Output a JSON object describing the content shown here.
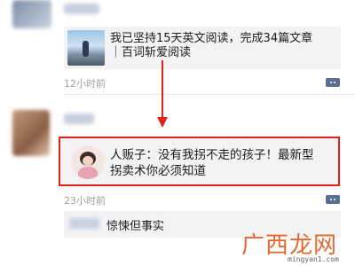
{
  "feed": {
    "post1": {
      "card_text_line1": "我已坚持15天英文阅读，完成34篇文章",
      "card_text_line2": "｜百词斩爱阅读",
      "time": "12小时前"
    },
    "post2": {
      "card_text_line1": "人贩子：没有我拐不走的孩子！最新型",
      "card_text_line2": "拐卖术你必须知道",
      "time": "23小时前",
      "comment_text": "惊悚但事实"
    }
  },
  "colors": {
    "highlight": "#e2231a",
    "more_button": "#5a6d93"
  },
  "watermark": {
    "brand": "广西龙网",
    "url": "mingyan1.com"
  }
}
